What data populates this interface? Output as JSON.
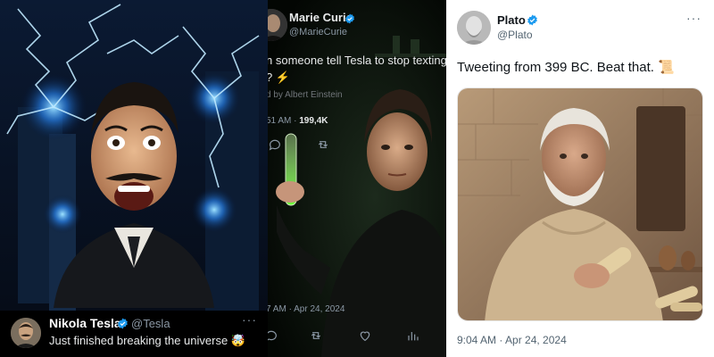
{
  "tesla": {
    "name": "Nikola Tesla",
    "handle": "@Tesla",
    "more": "···",
    "text": "Just finished breaking the universe 🤯"
  },
  "curie": {
    "name": "Marie Curie",
    "handle": "@MarieCurie",
    "text_line1": "n someone tell Tesla to stop texting",
    "text_line2": "? ⚡",
    "credit": "d by Albert Einstein",
    "time_partial": "51 AM ·",
    "views": "199,4K",
    "bottom_time": "7 AM · Apr 24, 2024"
  },
  "plato": {
    "name": "Plato",
    "handle": "@Plato",
    "more": "···",
    "text": "Tweeting from 399 BC. Beat that. 📜",
    "time": "9:04 AM · Apr 24, 2024"
  },
  "colors": {
    "verified": "#1d9bf0",
    "dark_bg": "#000000",
    "light_bg": "#ffffff",
    "secondary_text_dark": "#8b98a5",
    "secondary_text_light": "#536471"
  },
  "icons": [
    "verified-badge-icon",
    "more-icon",
    "reply-icon",
    "retweet-icon",
    "like-icon",
    "views-icon"
  ]
}
